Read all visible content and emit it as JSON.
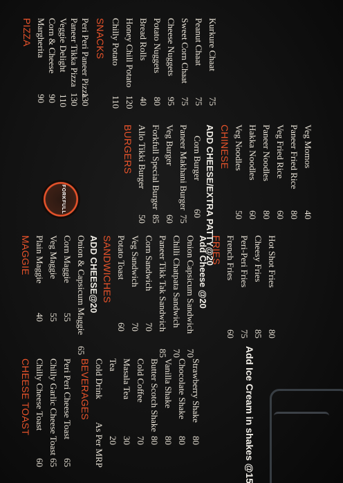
{
  "logo": {
    "text": "FORKFULL"
  },
  "colors": {
    "heading": "#e8532b",
    "text": "#e8e2d6",
    "background": "#121212"
  },
  "pizza": {
    "title": "PIZZA",
    "items": [
      {
        "name": "Margherita",
        "price": "90"
      },
      {
        "name": "Corn & Cheese",
        "price": "90"
      },
      {
        "name": "Veggie Delight",
        "price": "110"
      },
      {
        "name": "Paneer Tikka Pizza",
        "price": "130"
      },
      {
        "name": "Peri Peri Paneer Pizza",
        "price": "130"
      }
    ]
  },
  "snacks": {
    "title": "SNACKS",
    "items": [
      {
        "name": "Chilly Potato",
        "price": "110"
      },
      {
        "name": "Honey Chill Potato",
        "price": "120"
      },
      {
        "name": "Bread Rolls",
        "price": "40"
      },
      {
        "name": "Potato Nuggets",
        "price": "80"
      },
      {
        "name": "Cheese Nuggets",
        "price": "95"
      },
      {
        "name": "Sweet Corn Chaat",
        "price": "75"
      },
      {
        "name": "Peanut Chaat",
        "price": "75"
      },
      {
        "name": "Kurkure Chaat",
        "price": "75"
      }
    ]
  },
  "burgers": {
    "title": "BURGERS",
    "items": [
      {
        "name": "Allo Tikki Burger",
        "price": "50"
      },
      {
        "name": "Forkfull Special Burger",
        "price": "85"
      },
      {
        "name": "Veg Burger",
        "price": "60"
      },
      {
        "name": "Paneer Makhani Burger",
        "price": "75"
      },
      {
        "name": "Corn Burger",
        "price": "60"
      }
    ],
    "addon": "ADD CHEESE/EXTRA PATTY@20"
  },
  "chinese": {
    "title": "CHINESE",
    "items": [
      {
        "name": "Veg Noodles",
        "price": "50"
      },
      {
        "name": "Hakka Noodles",
        "price": "60"
      },
      {
        "name": "Paneer Noodles",
        "price": "80"
      },
      {
        "name": "Veg Fried Rice",
        "price": "60"
      },
      {
        "name": "Paneer Fried Rice",
        "price": "80"
      },
      {
        "name": "Veg Momos",
        "price": "40"
      }
    ]
  },
  "maggie": {
    "title": "MAGGIE",
    "items": [
      {
        "name": "Plain Maggie",
        "price": "40"
      },
      {
        "name": "Veg Maggie",
        "price": "55"
      },
      {
        "name": "Corn Maggie",
        "price": "55"
      },
      {
        "name": "Onion & Capsicum Maggie",
        "price": "65"
      }
    ],
    "addon": "ADD CHEESE@20"
  },
  "sandwiches": {
    "title": "SANDWICHES",
    "items": [
      {
        "name": "Potato Toast",
        "price": "60"
      },
      {
        "name": "Veg Sandwich",
        "price": "70"
      },
      {
        "name": "Corn Sandwich",
        "price": "70"
      },
      {
        "name": "Paneer Tikk Tak Sandwich",
        "price": "85"
      },
      {
        "name": "Chilli Chatpata Sandwich",
        "price": "70"
      },
      {
        "name": "Onion Capsicum Sandwich",
        "price": "70"
      }
    ],
    "addon": "Add Cheese @20"
  },
  "fries": {
    "title": "FRIES",
    "items": [
      {
        "name": "French Fries",
        "price": "60"
      },
      {
        "name": "Peri-Peri Fries",
        "price": "75"
      },
      {
        "name": "Cheesy Fries",
        "price": "85"
      },
      {
        "name": "Hot Shot Fries",
        "price": "80"
      }
    ]
  },
  "cheese_toast": {
    "title": "CHEESE TOAST",
    "items": [
      {
        "name": "Chilly Cheese Toast",
        "price": "60"
      },
      {
        "name": "Chilly Garlic Cheese Toast",
        "price": "65"
      },
      {
        "name": "Peri Peri Cheese Toast",
        "price": "65"
      }
    ]
  },
  "beverages": {
    "title": "BEVERAGES",
    "items": [
      {
        "name": "Cold Drink",
        "price": "As Per MRP"
      },
      {
        "name": "Tea",
        "price": "20"
      },
      {
        "name": "Masala Tea",
        "price": "30"
      },
      {
        "name": "Cold Coffee",
        "price": "70"
      },
      {
        "name": "Butter Scotch Shake",
        "price": "80"
      },
      {
        "name": "Vanilla Shake",
        "price": "80"
      },
      {
        "name": "Chocolate Shake",
        "price": "80"
      },
      {
        "name": "Strawberry Shake",
        "price": "80"
      }
    ],
    "addon": "Add Ice Cream in shakes @15"
  }
}
